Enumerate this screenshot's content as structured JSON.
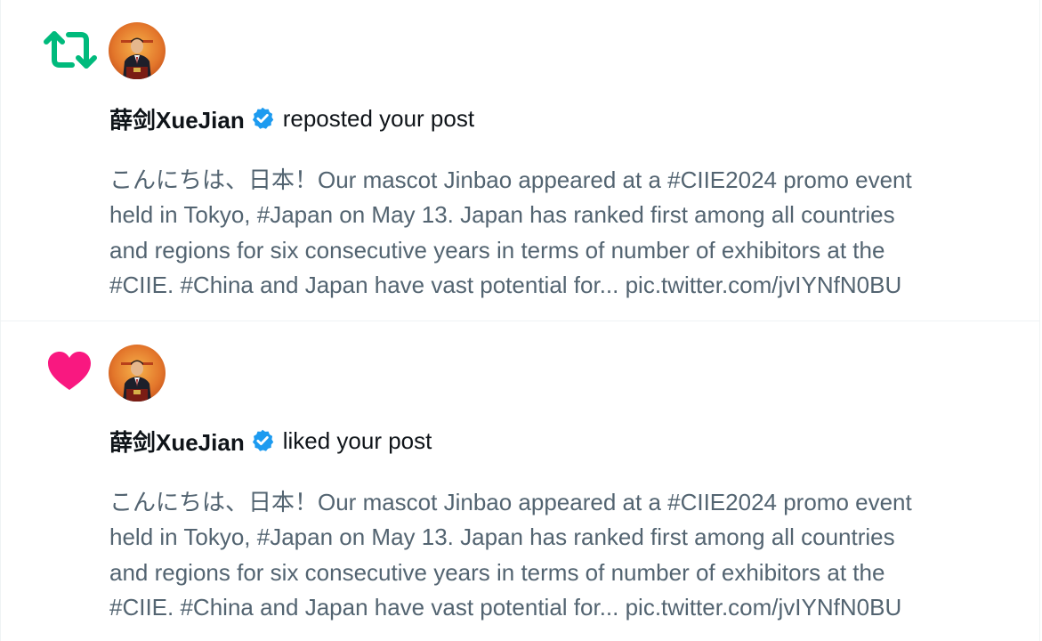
{
  "notifications": [
    {
      "type": "repost",
      "type_icon": "repost-icon",
      "icon_color": "#00ba7c",
      "user": {
        "name": "薛剑XueJian",
        "verified": true,
        "verified_color": "#1d9bf0",
        "avatar": "avatar-image"
      },
      "action": "reposted your post",
      "post_lines": [
        "こんにちは、日本！Our mascot Jinbao appeared at a #CIIE2024 promo event",
        "held in Tokyo, #Japan on May 13. Japan has ranked first among all countries",
        "and regions for six consecutive years in terms of number of exhibitors at the",
        "#CIIE. #China and Japan have vast potential for... pic.twitter.com/jvIYNfN0BU"
      ]
    },
    {
      "type": "like",
      "type_icon": "heart-icon",
      "icon_color": "#f91880",
      "user": {
        "name": "薛剑XueJian",
        "verified": true,
        "verified_color": "#1d9bf0",
        "avatar": "avatar-image"
      },
      "action": "liked your post",
      "post_lines": [
        "こんにちは、日本！Our mascot Jinbao appeared at a #CIIE2024 promo event",
        "held in Tokyo, #Japan on May 13. Japan has ranked first among all countries",
        "and regions for six consecutive years in terms of number of exhibitors at the",
        "#CIIE. #China and Japan have vast potential for... pic.twitter.com/jvIYNfN0BU"
      ]
    }
  ]
}
